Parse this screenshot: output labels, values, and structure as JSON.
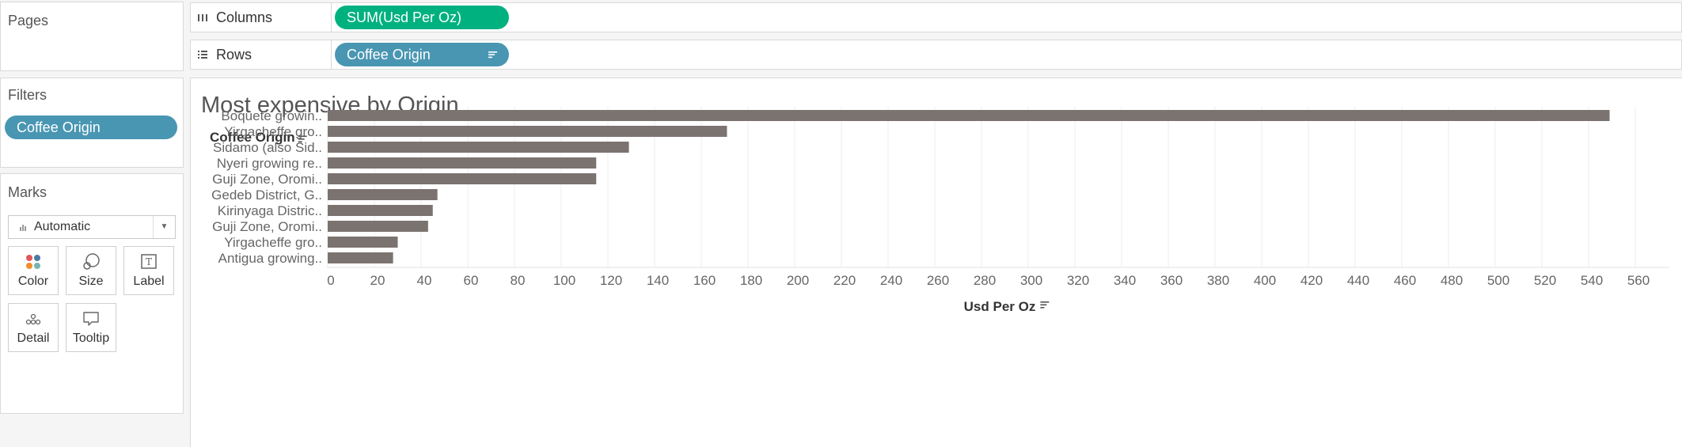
{
  "left_panel": {
    "pages_title": "Pages",
    "filters_title": "Filters",
    "filters": [
      {
        "label": "Coffee Origin"
      }
    ],
    "marks_title": "Marks",
    "mark_type": "Automatic",
    "mark_buttons": [
      {
        "label": "Color",
        "icon": "color-icon"
      },
      {
        "label": "Size",
        "icon": "size-icon"
      },
      {
        "label": "Label",
        "icon": "label-icon"
      },
      {
        "label": "Detail",
        "icon": "detail-icon"
      },
      {
        "label": "Tooltip",
        "icon": "tooltip-icon"
      }
    ]
  },
  "shelves": {
    "columns": {
      "label": "Columns",
      "pill": "SUM(Usd Per Oz)"
    },
    "rows": {
      "label": "Rows",
      "pill": "Coffee Origin"
    }
  },
  "colors": {
    "bar": "#7b7370",
    "pill_dimension": "#4996b2",
    "pill_measure": "#00b180"
  },
  "chart_data": {
    "type": "bar",
    "orientation": "horizontal",
    "title": "Most expensive by Origin",
    "ylabel": "Coffee Origin",
    "xlabel": "Usd Per Oz",
    "categories": [
      "Boquete growin..",
      "Yirgacheffe gro..",
      "Sidamo (also Sid..",
      "Nyeri growing re..",
      "Guji Zone, Oromi..",
      "Gedeb District, G..",
      "Kirinyaga Distric..",
      "Guji Zone, Oromi..",
      "Yirgacheffe gro..",
      "Antigua growing.."
    ],
    "values": [
      549,
      171,
      129,
      115,
      115,
      47,
      45,
      43,
      30,
      28
    ],
    "xlim": [
      0,
      560
    ],
    "xticks": [
      0,
      20,
      40,
      60,
      80,
      100,
      120,
      140,
      160,
      180,
      200,
      220,
      240,
      260,
      280,
      300,
      320,
      340,
      360,
      380,
      400,
      420,
      440,
      460,
      480,
      500,
      520,
      540,
      560
    ],
    "grid": true
  }
}
